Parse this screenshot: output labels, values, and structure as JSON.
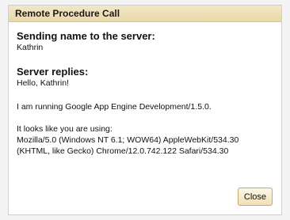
{
  "dialog": {
    "title": "Remote Procedure Call",
    "sending_label": "Sending name to the server:",
    "sending_value": "Kathrin",
    "replies_label": "Server replies:",
    "reply_value": "Hello, Kathrin!",
    "server_info": "I am running Google App Engine Development/1.5.0.",
    "browser_intro": "It looks like you are using:",
    "browser_line1": "Mozilla/5.0 (Windows NT 6.1; WOW64) AppleWebKit/534.30",
    "browser_line2": "(KHTML, like Gecko) Chrome/12.0.742.122 Safari/534.30",
    "close_label": "Close"
  },
  "colors": {
    "title_bar": "#ead8a8",
    "border": "#cfcfcf",
    "button_border": "#c8a96b"
  }
}
